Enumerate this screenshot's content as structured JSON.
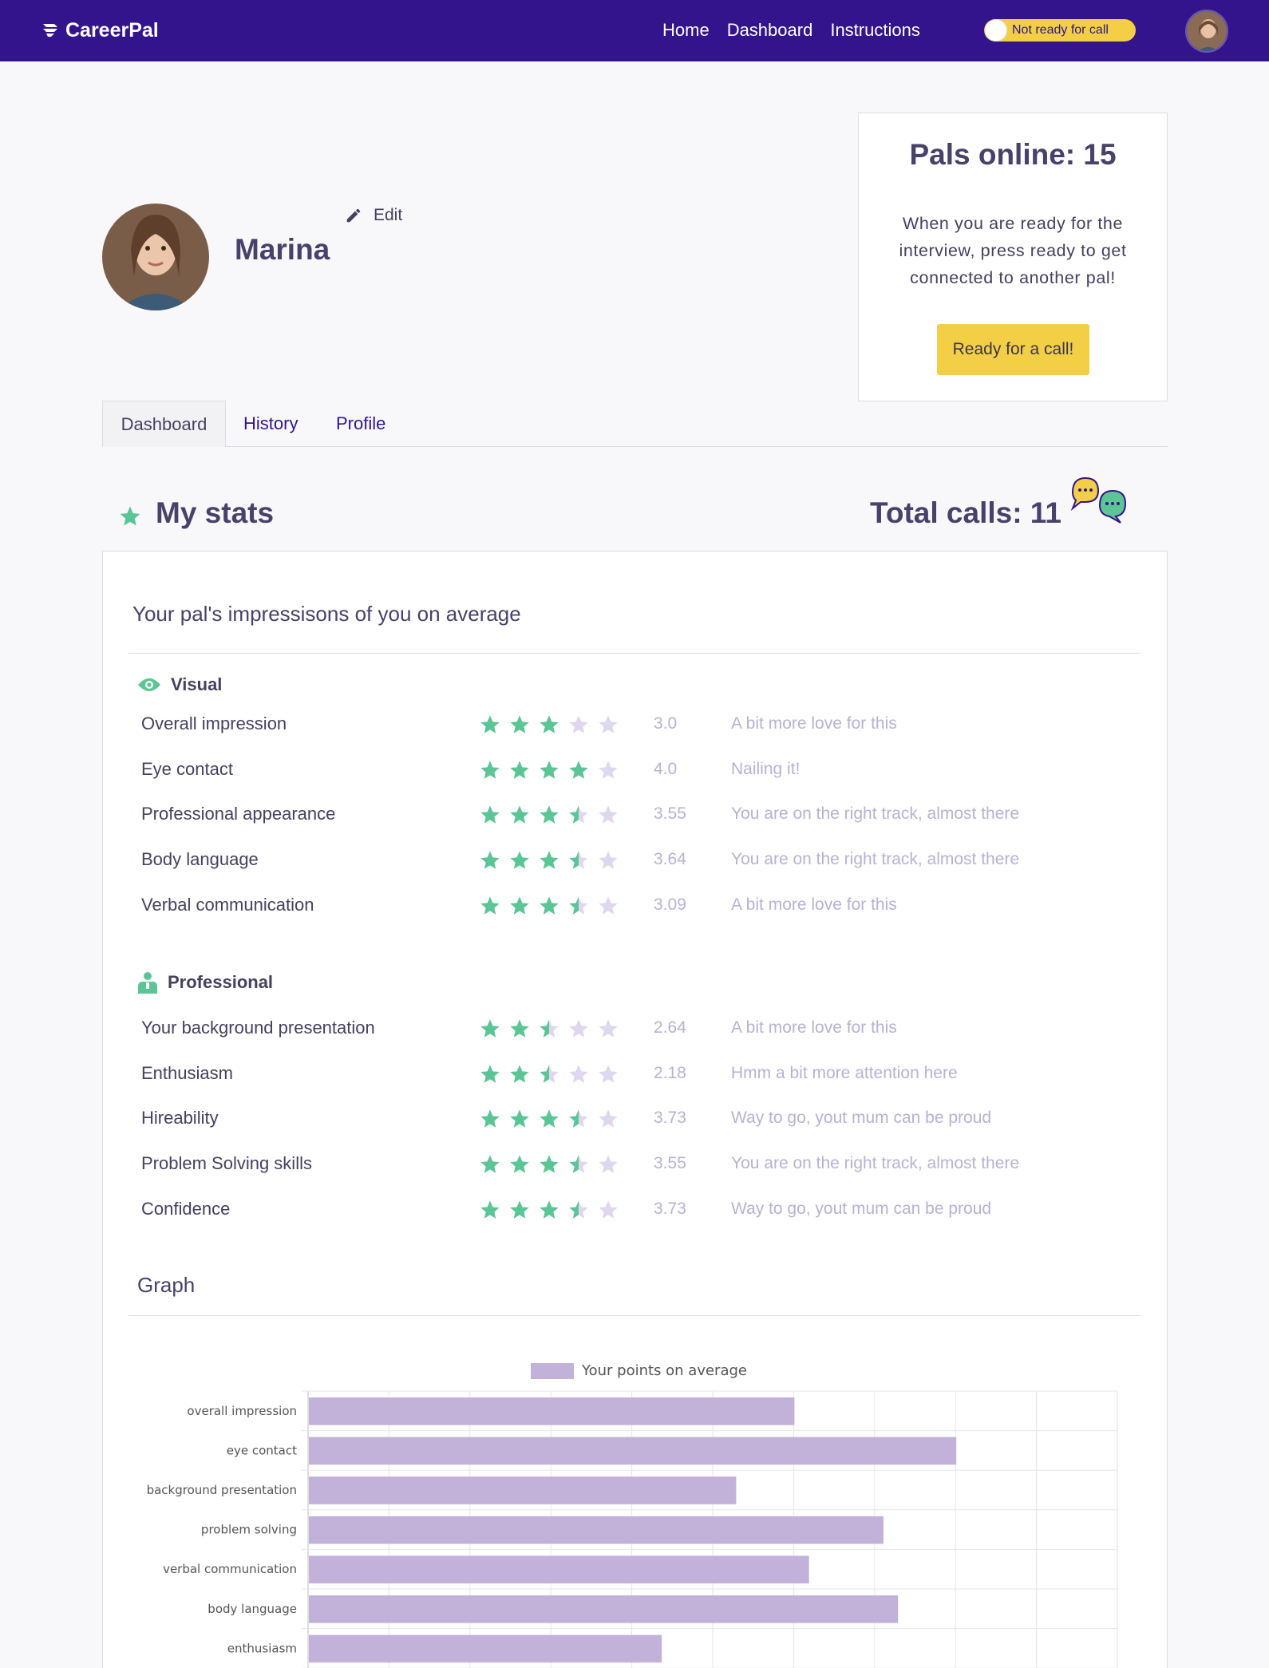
{
  "navbar": {
    "brand": "CareerPal",
    "links": [
      "Home",
      "Dashboard",
      "Instructions"
    ],
    "toggle_label": "Not ready for call"
  },
  "profile": {
    "name": "Marina",
    "edit_label": "Edit"
  },
  "pals_card": {
    "title": "Pals online: 15",
    "text": "When you are ready for the interview, press ready to get connected to another pal!",
    "button": "Ready for a call!"
  },
  "tabs": [
    "Dashboard",
    "History",
    "Profile"
  ],
  "stats": {
    "title": "My stats",
    "total_calls": "Total calls: 11",
    "impressions_title": "Your pal's impressisons of you on average",
    "sections": [
      {
        "title": "Visual",
        "icon": "eye-icon",
        "rows": [
          {
            "label": "Overall impression",
            "rating": 3.0,
            "score": "3.0",
            "comment": "A bit more love for this"
          },
          {
            "label": "Eye contact",
            "rating": 4.0,
            "score": "4.0",
            "comment": "Nailing it!"
          },
          {
            "label": "Professional appearance",
            "rating": 3.5,
            "score": "3.55",
            "comment": "You are on the right track, almost there"
          },
          {
            "label": "Body language",
            "rating": 3.5,
            "score": "3.64",
            "comment": "You are on the right track, almost there"
          },
          {
            "label": "Verbal communication",
            "rating": 3.5,
            "score": "3.09",
            "comment": "A bit more love for this"
          }
        ]
      },
      {
        "title": "Professional",
        "icon": "person-icon",
        "rows": [
          {
            "label": "Your background presentation",
            "rating": 2.5,
            "score": "2.64",
            "comment": "A bit more love for this"
          },
          {
            "label": "Enthusiasm",
            "rating": 2.5,
            "score": "2.18",
            "comment": "Hmm a bit more attention here"
          },
          {
            "label": "Hireability",
            "rating": 3.5,
            "score": "3.73",
            "comment": "Way to go, yout mum can be proud"
          },
          {
            "label": "Problem Solving skills",
            "rating": 3.5,
            "score": "3.55",
            "comment": "You are on the right track, almost there"
          },
          {
            "label": "Confidence",
            "rating": 3.5,
            "score": "3.73",
            "comment": "Way to go, yout mum can be proud"
          }
        ]
      }
    ],
    "graph_title": "Graph"
  },
  "chart_data": {
    "type": "bar",
    "orientation": "horizontal",
    "legend": "Your points on average",
    "categories": [
      "overall impression",
      "eye contact",
      "background presentation",
      "problem solving",
      "verbal communication",
      "body language",
      "enthusiasm"
    ],
    "values": [
      3.0,
      4.0,
      2.64,
      3.55,
      3.09,
      3.64,
      2.18
    ],
    "xlim": [
      0,
      5
    ],
    "grid": true,
    "bar_color": "#c2b1d9"
  },
  "colors": {
    "navbar": "#33148c",
    "accent_yellow": "#f3cf45",
    "star_filled": "#5cc595",
    "star_empty": "#e0d7ef",
    "muted_text": "#b7b2d3"
  }
}
